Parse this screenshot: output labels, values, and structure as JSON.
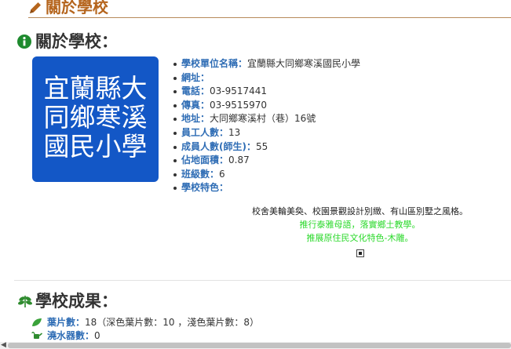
{
  "header": {
    "title": "關於學校",
    "icon": "pencil-icon",
    "color": "#b5651d"
  },
  "about": {
    "section_title": "關於學校：",
    "icon": "info-icon",
    "logo": {
      "lines": [
        "宜蘭縣大",
        "同鄉寒溪",
        "國民小學"
      ],
      "bg": "#1357c6"
    },
    "items": [
      {
        "label": "學校單位名稱：",
        "value": "宜蘭縣大同鄉寒溪國民小學"
      },
      {
        "label": "網址：",
        "value": ""
      },
      {
        "label": "電話：",
        "value": "03-9517441"
      },
      {
        "label": "傳真：",
        "value": "03-9515970"
      },
      {
        "label": "地址：",
        "value": "大同鄉寒溪村（巷）16號"
      },
      {
        "label": "員工人數：",
        "value": "13"
      },
      {
        "label": "成員人數(師生)：",
        "value": "55"
      },
      {
        "label": "佔地面積：",
        "value": "0.87"
      },
      {
        "label": "班級數：",
        "value": "6"
      },
      {
        "label": "學校特色：",
        "value": ""
      }
    ],
    "features": [
      "校舍美輪美奐、校園景觀設計別緻、有山區別墅之風格。",
      "推行泰雅母語，落實鄉土教學。",
      "推展原住民文化特色-木雕。"
    ]
  },
  "achievements": {
    "section_title": "學校成果：",
    "icon": "leaf-icon",
    "items": [
      {
        "label": "葉片數：",
        "value": "18（深色葉片數：10 ，淺色葉片數：8）",
        "icon": "leaf-icon"
      },
      {
        "label": "澆水器數：",
        "value": "0",
        "icon": "watering-can-icon"
      }
    ]
  }
}
